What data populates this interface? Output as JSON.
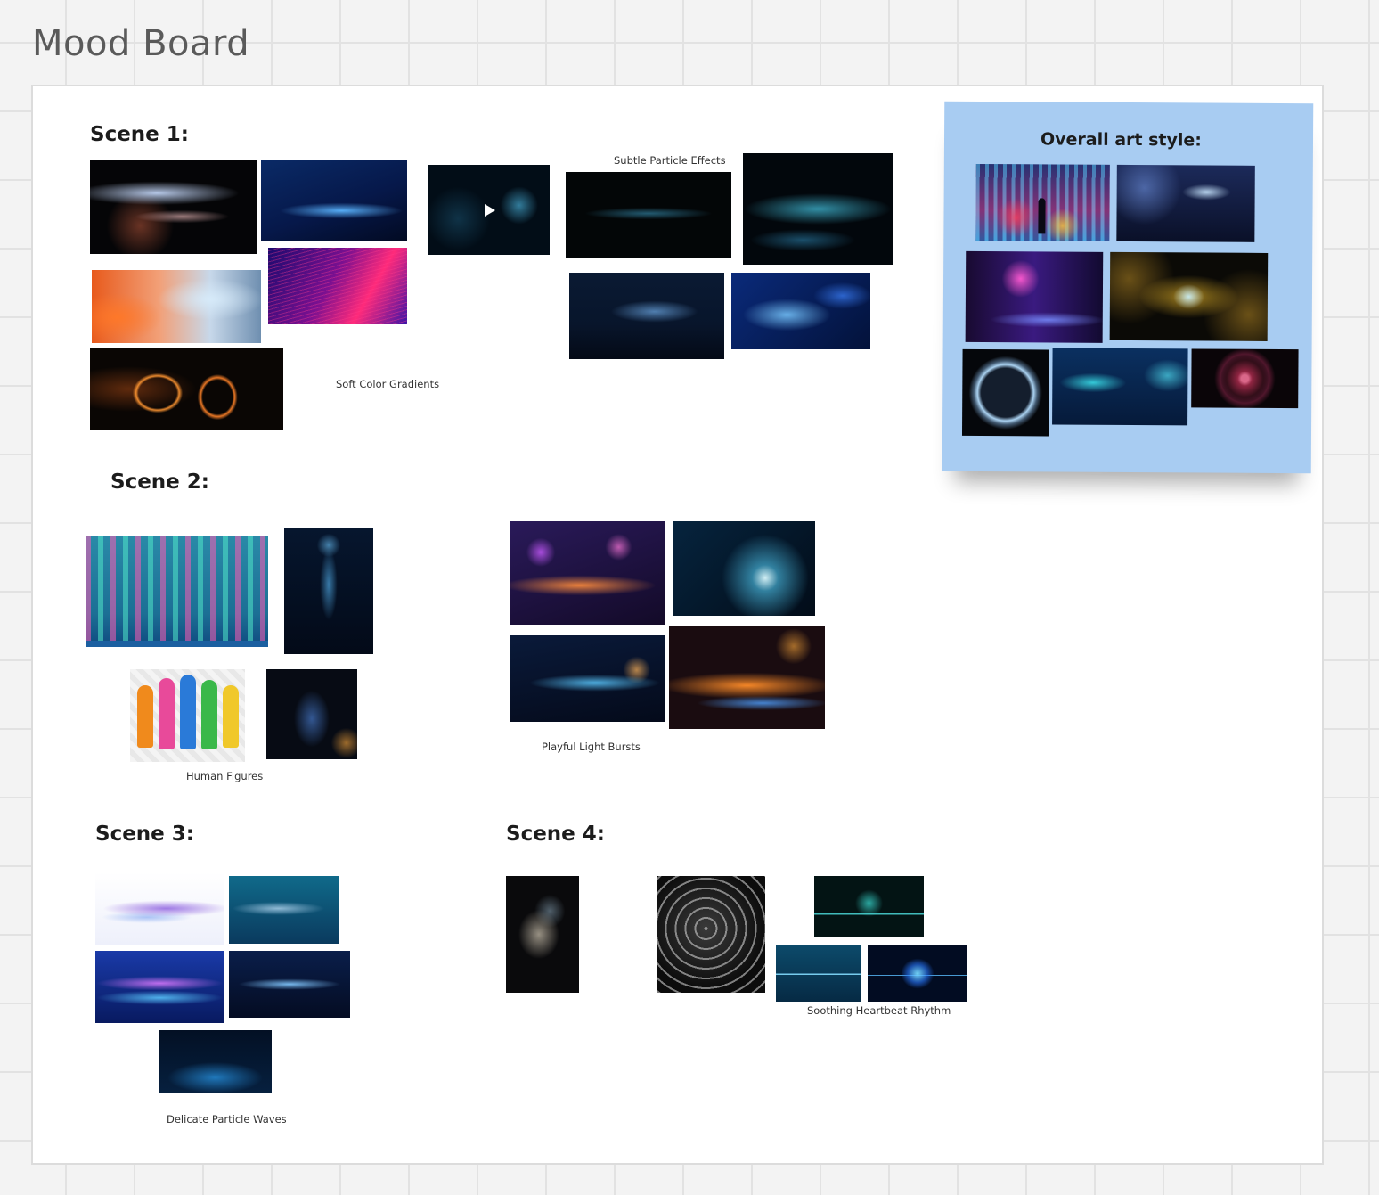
{
  "board": {
    "title": "Mood Board"
  },
  "sections": {
    "scene1": {
      "heading": "Scene 1:"
    },
    "scene2": {
      "heading": "Scene 2:"
    },
    "scene3": {
      "heading": "Scene 3:"
    },
    "scene4": {
      "heading": "Scene 4:"
    },
    "style": {
      "heading": "Overall art style:"
    }
  },
  "captions": {
    "subtle_particles": "Subtle Particle Effects",
    "soft_gradients": "Soft Color Gradients",
    "human_figures": "Human Figures",
    "light_bursts": "Playful Light Bursts",
    "particle_waves": "Delicate Particle Waves",
    "heartbeat": "Soothing Heartbeat Rhythm"
  },
  "icons": {
    "play": "play-icon"
  },
  "colors": {
    "canvas": "#f3f3f3",
    "frame": "#ffffff",
    "sticky_note": "#a8ccf2",
    "heading_text": "#1c1c1c",
    "title_text": "#5a5a5a"
  }
}
